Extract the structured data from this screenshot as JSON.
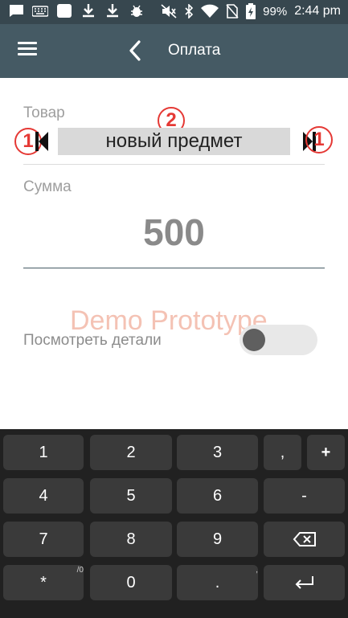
{
  "status_bar": {
    "battery": "99%",
    "time": "2:44 pm",
    "left_icons": [
      "message-icon",
      "keyboard-icon",
      "square-icon",
      "download-icon",
      "download-icon",
      "android-debug-icon"
    ],
    "right_icons": [
      "mute-icon",
      "bluetooth-icon",
      "wifi-icon",
      "no-sim-icon",
      "battery-charging-icon"
    ]
  },
  "app_bar": {
    "title": "Оплата",
    "background": "#455a64"
  },
  "form": {
    "item_label": "Товар",
    "item_value": "новый предмет",
    "amount_label": "Сумма",
    "amount_value": "500",
    "watermark": "Demo Prototype",
    "details_label": "Посмотреть детали",
    "details_toggle_on": false
  },
  "callouts": {
    "left_arrow": "1",
    "item": "2",
    "right_arrow": "1"
  },
  "keypad": {
    "rows": [
      [
        {
          "label": "1"
        },
        {
          "label": "2"
        },
        {
          "label": "3"
        },
        {
          "label": ","
        },
        {
          "label": "+"
        }
      ],
      [
        {
          "label": "4"
        },
        {
          "label": "5"
        },
        {
          "label": "6"
        },
        {
          "label": "-"
        }
      ],
      [
        {
          "label": "7"
        },
        {
          "label": "8"
        },
        {
          "label": "9"
        },
        {
          "label": "⌫",
          "icon": "backspace-icon"
        }
      ],
      [
        {
          "label": "*",
          "sub": "/0"
        },
        {
          "label": "0"
        },
        {
          "label": ".",
          "sub": ","
        },
        {
          "label": "↵",
          "icon": "enter-icon"
        }
      ]
    ]
  },
  "colors": {
    "status_bar": "#37474f",
    "accent_line": "#455a64",
    "callout": "#e53935",
    "keypad_bg": "#212121",
    "key_bg": "#3a3a3a"
  }
}
